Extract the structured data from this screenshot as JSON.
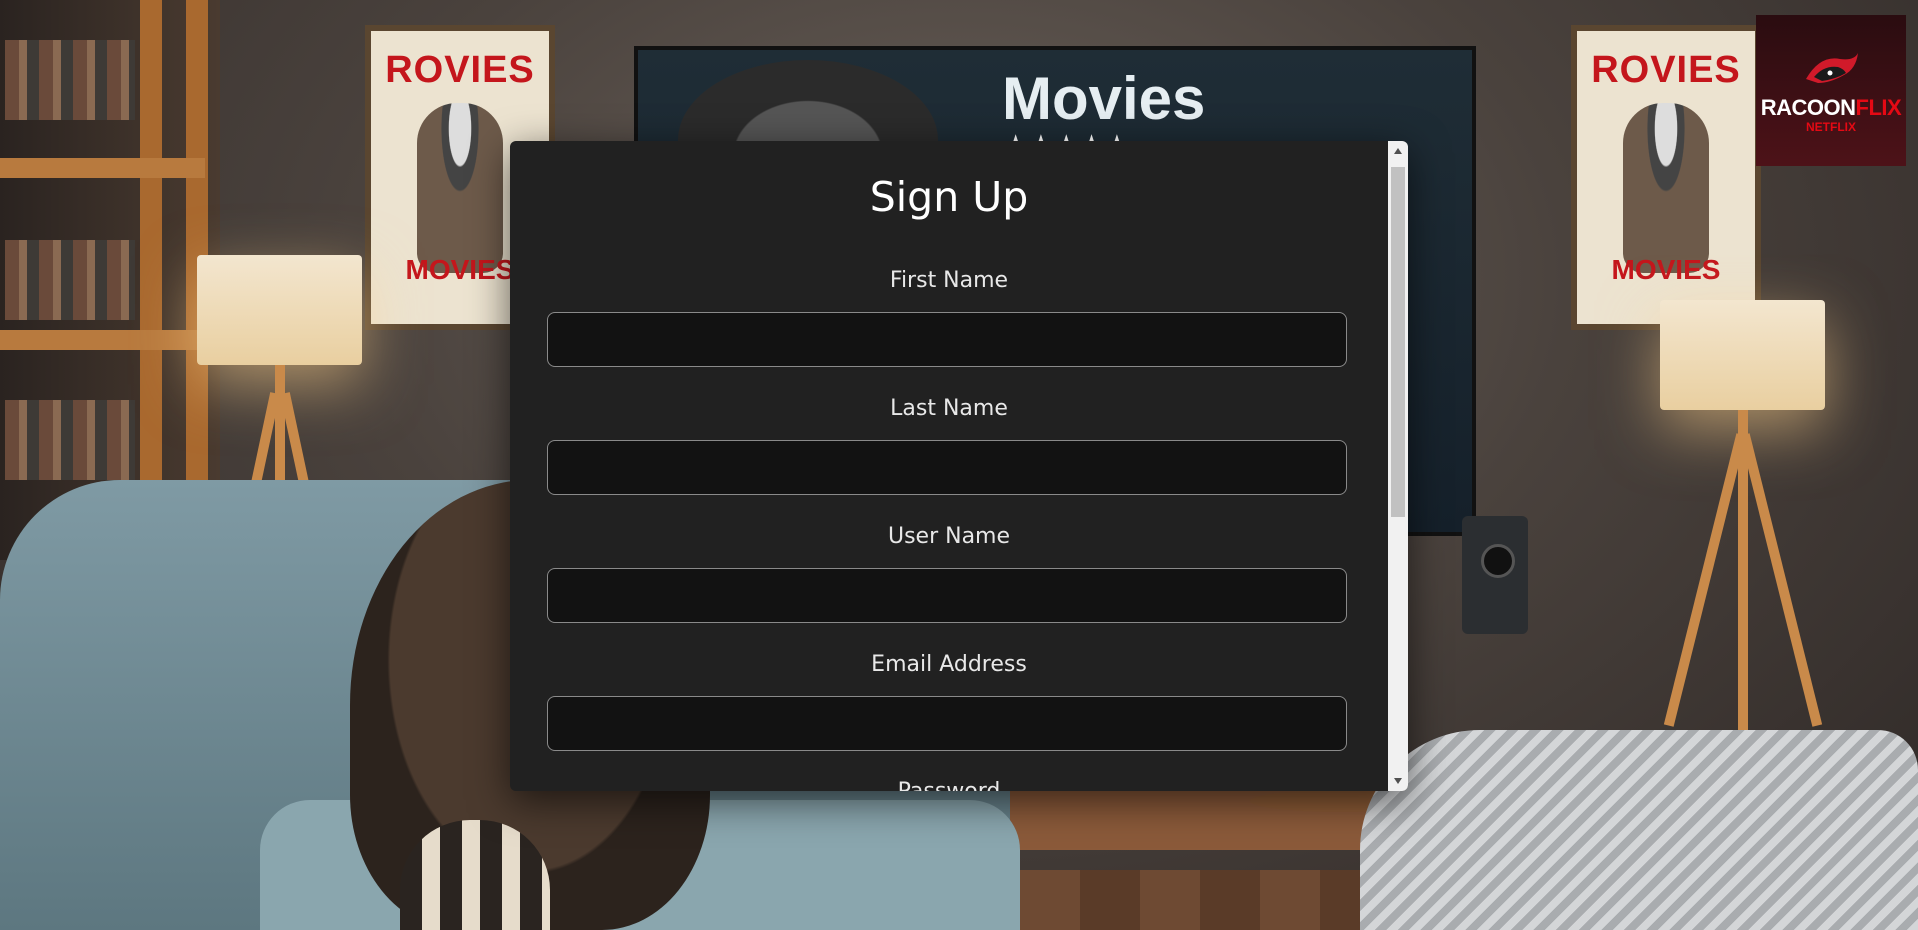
{
  "background": {
    "poster_left": {
      "top_text": "ROVIES",
      "bottom_text": "MOVIES"
    },
    "poster_right": {
      "top_text": "ROVIES",
      "bottom_text": "MOVIES"
    },
    "tv": {
      "title": "Movies",
      "stars": "★★★★★"
    }
  },
  "logo": {
    "brand_part1": "RACOON",
    "brand_part2": "FLIX",
    "sub": "NETFLIX"
  },
  "signup": {
    "title": "Sign Up",
    "fields": [
      {
        "label": "First Name",
        "value": ""
      },
      {
        "label": "Last Name",
        "value": ""
      },
      {
        "label": "User Name",
        "value": ""
      },
      {
        "label": "Email Address",
        "value": ""
      },
      {
        "label": "Password",
        "value": ""
      }
    ]
  },
  "colors": {
    "modal_bg": "#212121",
    "input_bg": "#121212",
    "brand_red": "#e50914"
  },
  "icons": {
    "scroll_up": "triangle-up-icon",
    "scroll_down": "triangle-down-icon"
  }
}
